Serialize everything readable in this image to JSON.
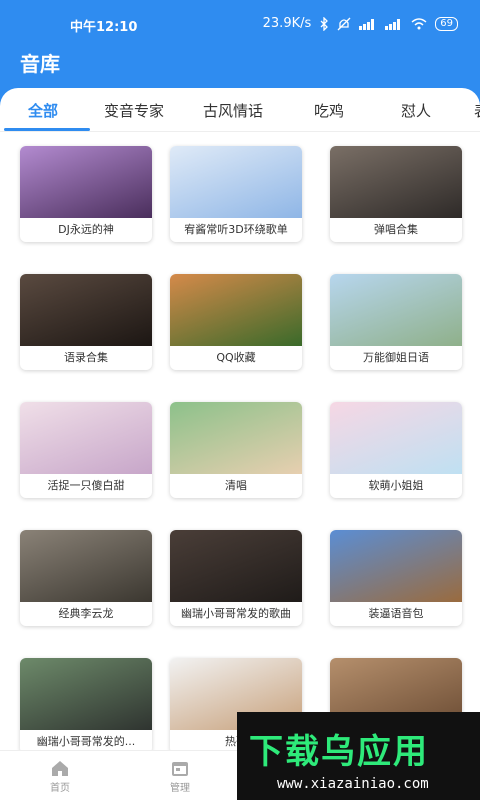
{
  "status_bar": {
    "time": "中午12:10",
    "speed": "23.9K/s",
    "battery": "69"
  },
  "app_title": "音库",
  "tabs": [
    {
      "label": "全部",
      "active": true
    },
    {
      "label": "变音专家",
      "active": false
    },
    {
      "label": "古风情话",
      "active": false
    },
    {
      "label": "吃鸡",
      "active": false
    },
    {
      "label": "怼人",
      "active": false
    },
    {
      "label": "表",
      "active": false
    }
  ],
  "cards": [
    {
      "label": "DJ永远的神",
      "color_top": "#b38bd0",
      "color_bottom": "#4a2e5c"
    },
    {
      "label": "宥酱常听3D环绕歌单",
      "color_top": "#dfeaf7",
      "color_bottom": "#8fb6e6"
    },
    {
      "label": "弹唱合集",
      "color_top": "#7a6f66",
      "color_bottom": "#2e2a28"
    },
    {
      "label": "语录合集",
      "color_top": "#5a4a40",
      "color_bottom": "#1c1613"
    },
    {
      "label": "QQ收藏",
      "color_top": "#d58a4a",
      "color_bottom": "#3a6a2a"
    },
    {
      "label": "万能御姐日语",
      "color_top": "#b7d6ee",
      "color_bottom": "#8fb08a"
    },
    {
      "label": "活捉一只傻白甜",
      "color_top": "#f0dfe8",
      "color_bottom": "#c7a6c9"
    },
    {
      "label": "清唱",
      "color_top": "#8cc18a",
      "color_bottom": "#e7cfb0"
    },
    {
      "label": "软萌小姐姐",
      "color_top": "#f6d7e4",
      "color_bottom": "#bfe0f2"
    },
    {
      "label": "经典李云龙",
      "color_top": "#8a8277",
      "color_bottom": "#3b3730"
    },
    {
      "label": "幽瑞小哥哥常发的歌曲",
      "color_top": "#4a3e38",
      "color_bottom": "#1f1b19"
    },
    {
      "label": "装逼语音包",
      "color_top": "#5b8ed4",
      "color_bottom": "#9a6b3e"
    },
    {
      "label": "幽瑞小哥哥常发的...",
      "color_top": "#6d8a6a",
      "color_bottom": "#2f3430"
    },
    {
      "label": "热歌",
      "color_top": "#f2f2f2",
      "color_bottom": "#c7a07a"
    },
    {
      "label": "",
      "color_top": "#b58f6c",
      "color_bottom": "#6a4b33"
    }
  ],
  "bottom_nav": [
    {
      "label": "首页",
      "icon": "home-icon"
    },
    {
      "label": "管理",
      "icon": "calendar-icon"
    }
  ],
  "watermark": {
    "title": "下载乌应用",
    "url": "www.xiazainiao.com"
  },
  "colors": {
    "accent": "#2f8cf0",
    "watermark_green": "#2eea7a"
  }
}
